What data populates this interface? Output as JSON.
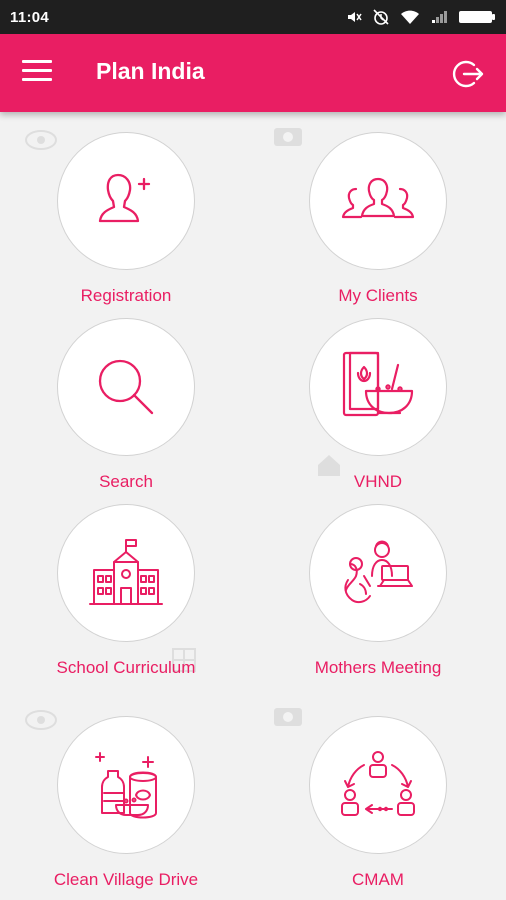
{
  "status_bar": {
    "time": "11:04",
    "icons": [
      "mute-icon",
      "alarm-off-icon",
      "wifi-icon",
      "signal-icon",
      "battery-icon"
    ]
  },
  "app_bar": {
    "title": "Plan India",
    "menu_icon": "hamburger-menu-icon",
    "logout_icon": "logout-icon"
  },
  "colors": {
    "accent": "#e91e63",
    "status_bar": "#1f1f1f",
    "background": "#f2f2f2",
    "tile_border": "#d2d2d2"
  },
  "tiles": [
    {
      "label": "Registration",
      "icon": "add-user-icon"
    },
    {
      "label": "My Clients",
      "icon": "group-icon"
    },
    {
      "label": "Search",
      "icon": "search-icon"
    },
    {
      "label": "VHND",
      "icon": "nutrition-book-icon"
    },
    {
      "label": "School Curriculum",
      "icon": "school-building-icon"
    },
    {
      "label": "Mothers Meeting",
      "icon": "meeting-icon"
    },
    {
      "label": "Clean Village Drive",
      "icon": "cleaning-supplies-icon"
    },
    {
      "label": "CMAM",
      "icon": "cycle-people-icon"
    }
  ]
}
